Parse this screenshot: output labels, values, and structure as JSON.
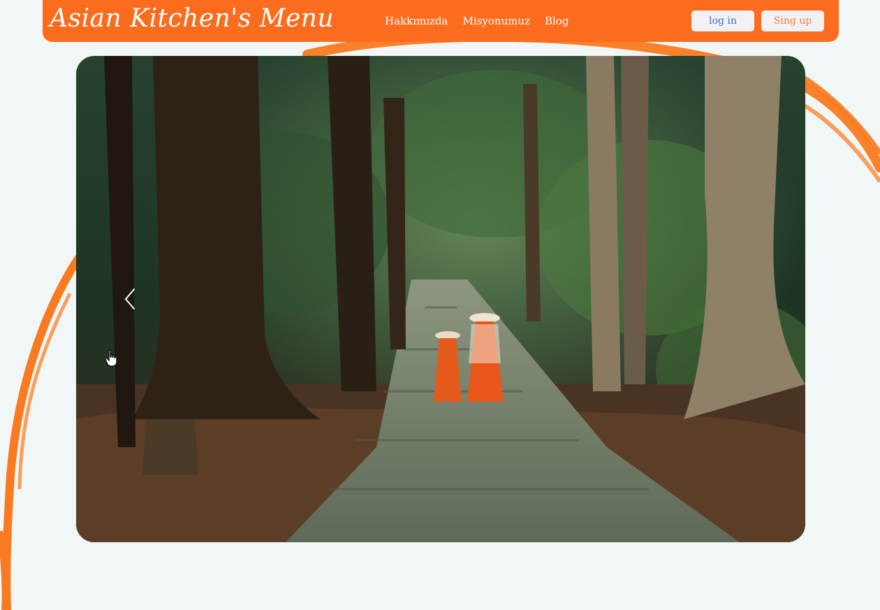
{
  "brand": {
    "title": "Asian Kitchen's Menu"
  },
  "nav": {
    "links": [
      "Hakkımızda",
      "Misyonumuz",
      "Blog"
    ]
  },
  "auth": {
    "login_label": "log in",
    "signup_label": "Sing up"
  },
  "carousel": {
    "prev_icon": "chevron-left-icon"
  },
  "colors": {
    "accent": "#fb6c1e",
    "background": "#f1f6f6",
    "login_text": "#3f6ac7",
    "signup_text": "#f37a45"
  }
}
